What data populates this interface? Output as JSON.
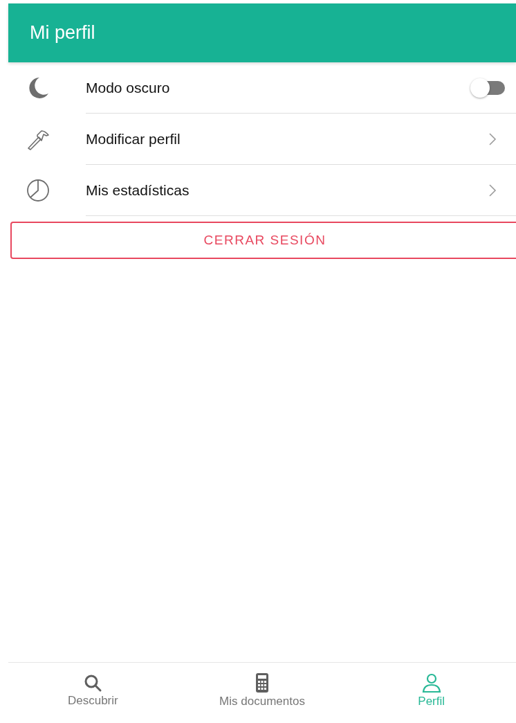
{
  "header": {
    "title": "Mi perfil"
  },
  "settings": [
    {
      "kind": "toggle",
      "label": "Modo oscuro",
      "on": false
    },
    {
      "kind": "link",
      "label": "Modificar perfil"
    },
    {
      "kind": "link",
      "label": "Mis estadísticas"
    }
  ],
  "logout_button": "CERRAR SESIÓN",
  "tabs": [
    {
      "label": "Descubrir",
      "selected": false
    },
    {
      "label": "Mis documentos",
      "selected": false
    },
    {
      "label": "Perfil",
      "selected": true
    }
  ]
}
